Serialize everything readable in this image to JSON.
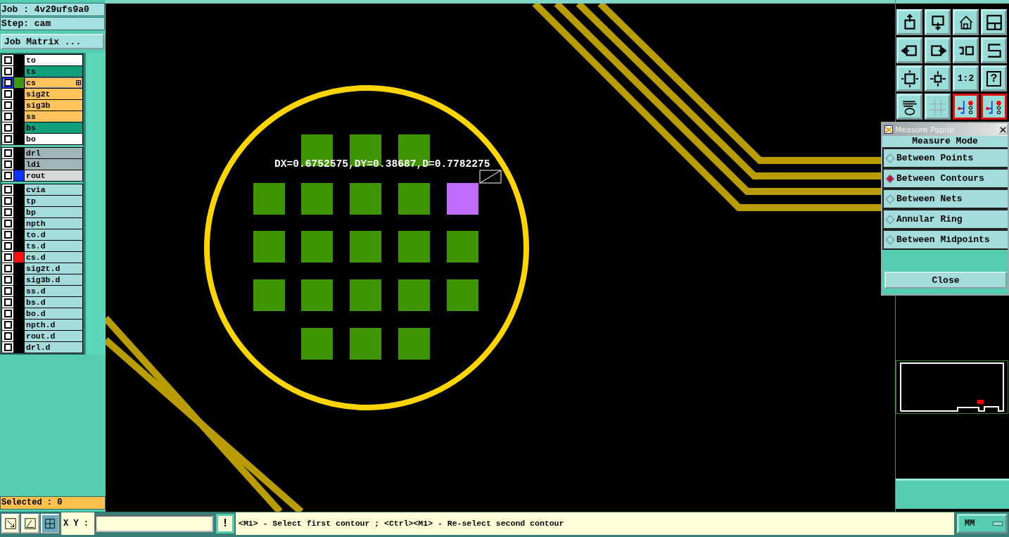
{
  "job": "Job : 4v29ufs9a0",
  "step": "Step: cam",
  "matrix_button": "Job Matrix ...",
  "layer_groups": [
    {
      "layers": [
        {
          "name": "to",
          "kind": "silk",
          "checked": false,
          "selected": false
        },
        {
          "name": "ts",
          "kind": "mask",
          "checked": false,
          "selected": false
        },
        {
          "name": "cs",
          "kind": "signal",
          "color": "#3f9a10",
          "checked": false,
          "selected": true
        },
        {
          "name": "sig2t",
          "kind": "signal",
          "checked": false,
          "selected": false
        },
        {
          "name": "sig3b",
          "kind": "signal",
          "checked": false,
          "selected": false
        },
        {
          "name": "ss",
          "kind": "signal",
          "checked": false,
          "selected": false
        },
        {
          "name": "bs",
          "kind": "mask",
          "checked": false,
          "selected": false
        },
        {
          "name": "bo",
          "kind": "silk",
          "checked": false,
          "selected": false
        }
      ]
    },
    {
      "layers": [
        {
          "name": "drl",
          "kind": "drill",
          "checked": false,
          "selected": false
        },
        {
          "name": "ldi",
          "kind": "drill",
          "checked": false,
          "selected": false
        },
        {
          "name": "rout",
          "kind": "rout",
          "color": "#1030ff",
          "checked": false,
          "selected": false
        }
      ]
    },
    {
      "layers": [
        {
          "name": "cvia",
          "kind": "document",
          "checked": false,
          "selected": false
        },
        {
          "name": "tp",
          "kind": "document",
          "checked": false,
          "selected": false
        },
        {
          "name": "bp",
          "kind": "document",
          "checked": false,
          "selected": false
        },
        {
          "name": "npth",
          "kind": "document",
          "checked": false,
          "selected": false
        },
        {
          "name": "to.d",
          "kind": "document",
          "checked": false,
          "selected": false
        },
        {
          "name": "ts.d",
          "kind": "document",
          "checked": false,
          "selected": false
        },
        {
          "name": "cs.d",
          "kind": "document",
          "color": "#ff1010",
          "checked": false,
          "selected": false
        },
        {
          "name": "sig2t.d",
          "kind": "document",
          "checked": false,
          "selected": false
        },
        {
          "name": "sig3b.d",
          "kind": "document",
          "checked": false,
          "selected": false
        },
        {
          "name": "ss.d",
          "kind": "document",
          "checked": false,
          "selected": false
        },
        {
          "name": "bs.d",
          "kind": "document",
          "checked": false,
          "selected": false
        },
        {
          "name": "bo.d",
          "kind": "document",
          "checked": false,
          "selected": false
        },
        {
          "name": "npth.d",
          "kind": "document",
          "checked": false,
          "selected": false
        },
        {
          "name": "rout.d",
          "kind": "document",
          "checked": false,
          "selected": false
        },
        {
          "name": "drl.d",
          "kind": "document",
          "checked": false,
          "selected": false
        }
      ]
    }
  ],
  "selected_count": "Selected : 0",
  "measurement": "DX=0.6752575,DY=0.38687,D=0.7782275",
  "toolbar": [
    {
      "kind": "up",
      "active": false
    },
    {
      "kind": "down",
      "active": false
    },
    {
      "kind": "home",
      "active": false
    },
    {
      "kind": "window",
      "active": false
    },
    {
      "kind": "left",
      "active": false
    },
    {
      "kind": "right",
      "active": false
    },
    {
      "kind": "undo",
      "active": false
    },
    {
      "kind": "route",
      "active": false
    },
    {
      "kind": "fit",
      "active": false
    },
    {
      "kind": "center",
      "active": false
    },
    {
      "kind": "scale",
      "label": "1:2",
      "active": false
    },
    {
      "kind": "help",
      "label": "?",
      "active": false
    },
    {
      "kind": "tools",
      "active": false
    },
    {
      "kind": "grid",
      "active": false
    },
    {
      "kind": "net",
      "active": true
    },
    {
      "kind": "net",
      "active": true
    }
  ],
  "popup": {
    "title": "Measure Popup",
    "heading": "Measure Mode",
    "options": [
      {
        "label": "Between Points",
        "selected": false
      },
      {
        "label": "Between Contours",
        "selected": true
      },
      {
        "label": "Between Nets",
        "selected": false
      },
      {
        "label": "Annular Ring",
        "selected": false
      },
      {
        "label": "Between Midpoints",
        "selected": false
      }
    ],
    "close_button": "Close"
  },
  "bottom_bar": {
    "xy_label": "X Y :",
    "warning_button": "!",
    "message": "<M1> - Select first contour ; <Ctrl><M1> - Re-select second contour",
    "units": "MM"
  }
}
